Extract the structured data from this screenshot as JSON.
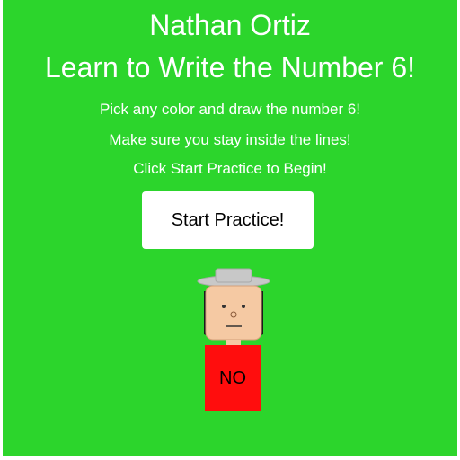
{
  "header": {
    "name": "Nathan Ortiz",
    "title": "Learn to Write the Number 6!"
  },
  "instructions": [
    "Pick any color and draw the number 6!",
    "Make sure you stay inside the lines!",
    "Click Start Practice to Begin!"
  ],
  "start_button": {
    "label": "Start Practice!"
  },
  "character": {
    "sign_text": "NO"
  },
  "colors": {
    "background": "#2cd52c",
    "button": "#ffffff",
    "sign": "#ff0d0d",
    "skin": "#f5c9a3",
    "hat": "#c8c8c8"
  }
}
